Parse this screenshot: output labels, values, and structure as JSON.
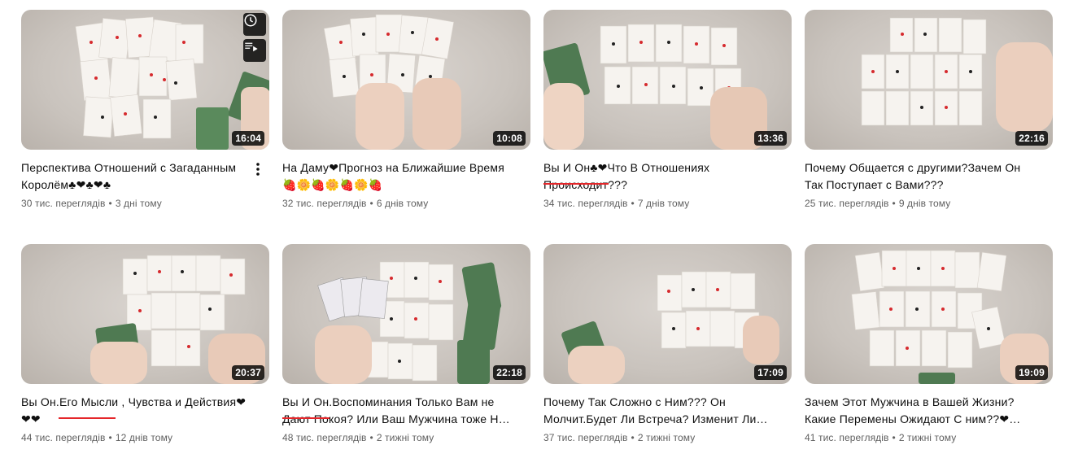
{
  "videos": [
    {
      "title": "Перспектива Отношений с Загаданным Королём♣❤♣❤♣",
      "duration": "16:04",
      "views": "30 тис. переглядів",
      "age": "3 дні тому"
    },
    {
      "title": "На Даму❤Прогноз на Ближайшие Время 🍓🌼🍓🌼🍓🌼🍓",
      "duration": "10:08",
      "views": "32 тис. переглядів",
      "age": "6 днів тому"
    },
    {
      "title": "Вы И Он♣❤Что В Отношениях Происходит???",
      "duration": "13:36",
      "views": "34 тис. переглядів",
      "age": "7 днів тому"
    },
    {
      "title": "Почему Общается с другими?Зачем Он Так Поступает с Вами???",
      "duration": "22:16",
      "views": "25 тис. переглядів",
      "age": "9 днів тому"
    },
    {
      "title": "Вы Он.Его Мысли , Чувства и Действия❤❤❤",
      "duration": "20:37",
      "views": "44 тис. переглядів",
      "age": "12 днів тому"
    },
    {
      "title": "Вы И Он.Воспоминания Только Вам не Дают Покоя? Или Ваш Мужчина тоже Н…",
      "duration": "22:18",
      "views": "48 тис. переглядів",
      "age": "2 тижні тому"
    },
    {
      "title": "Почему Так Сложно с Ним??? Он Молчит.Будет Ли Встреча? Изменит Ли…",
      "duration": "17:09",
      "views": "37 тис. переглядів",
      "age": "2 тижні тому"
    },
    {
      "title": "Зачем Этот Мужчина в Вашей Жизни? Какие Перемены Ожидают С ним??❤…",
      "duration": "19:09",
      "views": "41 тис. переглядів",
      "age": "2 тижні тому"
    }
  ],
  "separator": "•",
  "colors": {
    "table": "#cbc5bf",
    "card": "#f6f3ef",
    "red": "#d62a2e",
    "green": "#4f7a52",
    "underline": "#e5262a"
  }
}
